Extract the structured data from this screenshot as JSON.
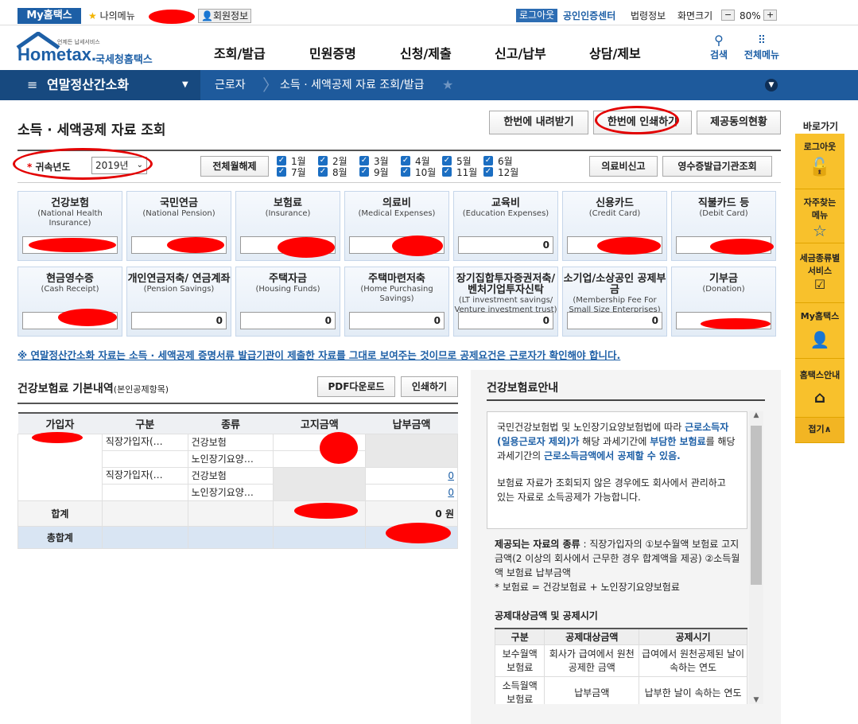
{
  "topbar": {
    "my_hometax": "My홈택스",
    "my_menu": "나의메뉴",
    "member_info": "회원정보",
    "logout": "로그아웃",
    "cert_center": "공인인증센터",
    "law_info": "법령정보",
    "screen_size": "화면크기",
    "zoom": "80%",
    "minus": "−",
    "plus": "+"
  },
  "header": {
    "logo_small": "언제든 납세서비스",
    "logo_main": "Hometax.",
    "logo_sub": "국세청홈택스",
    "menus": [
      "조회/발급",
      "민원증명",
      "신청/제출",
      "신고/납부",
      "상담/제보"
    ],
    "search": "검색",
    "all_menu": "전체메뉴"
  },
  "location": {
    "section": "연말정산간소화",
    "level2": "근로자",
    "level3": "소득 · 세액공제 자료 조회/발급"
  },
  "page": {
    "title": "소득 · 세액공제 자료 조회",
    "btn_download_all": "한번에 내려받기",
    "btn_print_all": "한번에 인쇄하기",
    "btn_consent": "제공동의현황"
  },
  "filter": {
    "year_label": "귀속년도",
    "year_value": "2019년",
    "btn_uncheck_all": "전체월해제",
    "months": [
      "1월",
      "2월",
      "3월",
      "4월",
      "5월",
      "6월",
      "7월",
      "8월",
      "9월",
      "10월",
      "11월",
      "12월"
    ],
    "btn_medical": "의료비신고",
    "btn_receipt_org": "영수증발급기관조회"
  },
  "cards": [
    {
      "ko": "건강보험",
      "en": "(National Health Insurance)",
      "value": ""
    },
    {
      "ko": "국민연금",
      "en": "(National Pension)",
      "value": ""
    },
    {
      "ko": "보험료",
      "en": "(Insurance)",
      "value": ""
    },
    {
      "ko": "의료비",
      "en": "(Medical Expenses)",
      "value": ""
    },
    {
      "ko": "교육비",
      "en": "(Education Expenses)",
      "value": "0"
    },
    {
      "ko": "신용카드",
      "en": "(Credit Card)",
      "value": ""
    },
    {
      "ko": "직불카드 등",
      "en": "(Debit Card)",
      "value": ""
    },
    {
      "ko": "현금영수증",
      "en": "(Cash Receipt)",
      "value": ""
    },
    {
      "ko": "개인연금저축/ 연금계좌",
      "en": "(Pension Savings)",
      "value": "0"
    },
    {
      "ko": "주택자금",
      "en": "(Housing Funds)",
      "value": "0"
    },
    {
      "ko": "주택마련저축",
      "en": "(Home Purchasing Savings)",
      "value": "0"
    },
    {
      "ko": "장기집합투자증권저축/ 벤처기업투자신탁",
      "en": "(LT investment savings/ Venture investment trust)",
      "value": "0"
    },
    {
      "ko": "소기업/소상공인 공제부금",
      "en": "(Membership Fee For Small Size Enterprises)",
      "value": "0"
    },
    {
      "ko": "기부금",
      "en": "(Donation)",
      "value": ""
    }
  ],
  "notice": "※ 연말정산간소화 자료는 소득 · 세액공제 증명서류 발급기관이 제출한 자료를 그대로 보여주는 것이므로 공제요건은 근로자가 확인해야 합니다.",
  "detail": {
    "title": "건강보험료 기본내역",
    "title_note": "(본인공제항목)",
    "btn_pdf": "PDF다운로드",
    "btn_print": "인쇄하기",
    "headers": [
      "가입자",
      "구분",
      "종류",
      "고지금액",
      "납부금액"
    ],
    "rows": [
      {
        "type": "직장가입자(…",
        "kind": "건강보험"
      },
      {
        "type": "",
        "kind": "노인장기요양…"
      },
      {
        "type": "직장가입자(…",
        "kind": "건강보험",
        "paid": "0"
      },
      {
        "type": "",
        "kind": "노인장기요양…",
        "paid": "0"
      }
    ],
    "sum_label": "합계",
    "sum_paid": "0 원",
    "total_label": "총합계"
  },
  "guide": {
    "title": "건강보험료안내",
    "box_text1": "국민건강보험법 및 노인장기요양보험법에 따라 ",
    "box_text1_hl": "근로소득자(일용근로자 제외)가",
    "box_text2": " 해당 과세기간에 ",
    "box_text2_hl": "부담한 보험료",
    "box_text3": "를 해당 과세기간의 ",
    "box_text3_hl": "근로소득금액에서 공제할 수 있음.",
    "box_text4": "보험료 자료가 조회되지 않은 경우에도 회사에서 관리하고 있는 자료로 소득공제가 가능합니다.",
    "provided_label": "제공되는 자료의 종류",
    "provided_text": " : 직장가입자의 ①보수월액 보험료 고지금액(2 이상의 회사에서 근무한 경우 합계액을 제공) ②소득월액 보험료 납부금액",
    "formula": "* 보험료 = 건강보험료 + 노인장기요양보험료",
    "deduct_label": "공제대상금액 및 공제시기",
    "table_headers": [
      "구분",
      "공제대상금액",
      "공제시기"
    ],
    "table_rows": [
      [
        "보수월액 보험료",
        "회사가 급여에서 원천공제한 금액",
        "급여에서 원천공제된 날이 속하는 연도"
      ],
      [
        "소득월액 보험료",
        "납부금액",
        "납부한 날이 속하는 연도"
      ]
    ]
  },
  "sidebar": {
    "title": "바로가기",
    "items": [
      "로그아웃",
      "자주찾는 메뉴",
      "세금종류별 서비스",
      "My홈택스",
      "홈택스안내"
    ],
    "fold": "접기∧"
  }
}
